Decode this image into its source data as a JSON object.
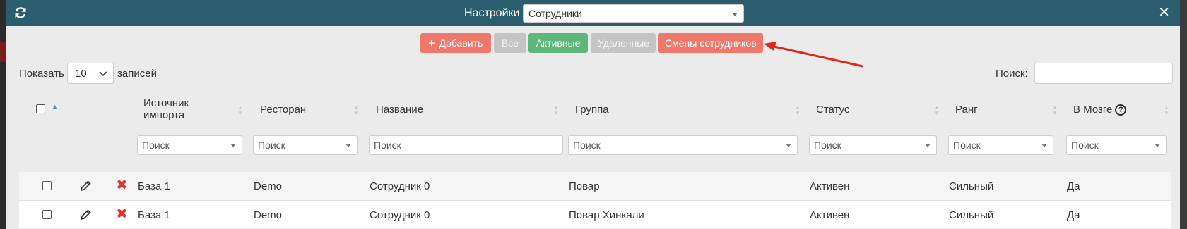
{
  "titlebar": {
    "settings_label": "Настройки",
    "section_select_value": "Сотрудники",
    "refresh_icon": "refresh-icon",
    "close_icon": "close-icon",
    "close_glyph": "✕",
    "background_color": "#2a5d6e"
  },
  "toolbar": {
    "add_label": "Добавить",
    "add_glyph": "+",
    "all_label": "Все",
    "active_label": "Активные",
    "deleted_label": "Удаленные",
    "shifts_label": "Смены сотрудников",
    "colors": {
      "red": "#f0786a",
      "green": "#5cb87a",
      "gray": "#c4c4c4"
    }
  },
  "length_control": {
    "show_label": "Показать",
    "value": "10",
    "records_label": "записей"
  },
  "search": {
    "label": "Поиск:",
    "value": ""
  },
  "columns": {
    "source": "Источник импорта",
    "restaurant": "Ресторан",
    "name": "Название",
    "group": "Группа",
    "status": "Статус",
    "rank": "Ранг",
    "in_brain": "В Мозге"
  },
  "filters": {
    "source": "Поиск",
    "restaurant": "Поиск",
    "name": "Поиск",
    "group": "Поиск",
    "status": "Поиск",
    "rank": "Поиск",
    "in_brain": "Поиск"
  },
  "rows": [
    {
      "source": "База 1",
      "restaurant": "Demo",
      "name": "Сотрудник 0",
      "group": "Повар",
      "status": "Активен",
      "rank": "Сильный",
      "in_brain": "Да"
    },
    {
      "source": "База 1",
      "restaurant": "Demo",
      "name": "Сотрудник 0",
      "group": "Повар Хинкали",
      "status": "Активен",
      "rank": "Сильный",
      "in_brain": "Да"
    }
  ]
}
